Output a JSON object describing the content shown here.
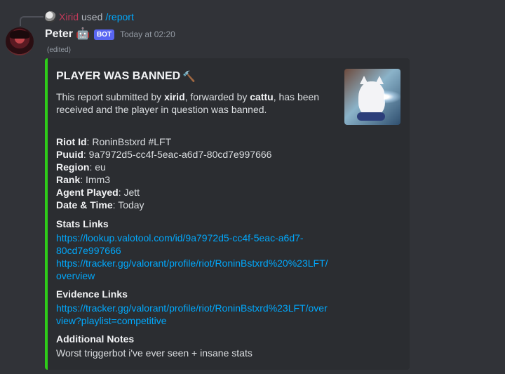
{
  "reply": {
    "username": "Xirid",
    "used_text": "used",
    "command": "/report"
  },
  "message": {
    "username": "Peter",
    "bot_tag": "BOT",
    "timestamp": "Today at 02:20",
    "edited": "(edited)"
  },
  "embed": {
    "accent_color": "#2ecc1a",
    "title": "PLAYER WAS BANNED",
    "title_icon": "hammer-icon",
    "desc_prefix": "This report submitted by ",
    "desc_submitter": "xirid",
    "desc_mid": ", forwarded by ",
    "desc_forwarder": "cattu",
    "desc_suffix": ", has been received and the player in question was banned.",
    "fields": [
      {
        "label": "Riot Id",
        "value": "RoninBstxrd #LFT"
      },
      {
        "label": "Puuid",
        "value": "9a7972d5-cc4f-5eac-a6d7-80cd7e997666"
      },
      {
        "label": "Region",
        "value": "eu"
      },
      {
        "label": "Rank",
        "value": "Imm3"
      },
      {
        "label": "Agent Played",
        "value": "Jett"
      },
      {
        "label": "Date & Time",
        "value": "Today"
      }
    ],
    "stats_title": "Stats Links",
    "stats_link1_line1": "https://lookup.valotool.com/id/9a7972d5-cc4f-5eac-a6d7-",
    "stats_link1_line2": "80cd7e997666",
    "stats_link2_line1": "https://tracker.gg/valorant/profile/riot/RoninBstxrd%20%23LFT/",
    "stats_link2_line2": "overview",
    "evidence_title": "Evidence Links",
    "evidence_link_line1": "https://tracker.gg/valorant/profile/riot/RoninBstxrd%23LFT/over",
    "evidence_link_line2": "view?playlist=competitive",
    "notes_title": "Additional Notes",
    "notes_text": "Worst triggerbot i've ever seen + insane stats"
  }
}
